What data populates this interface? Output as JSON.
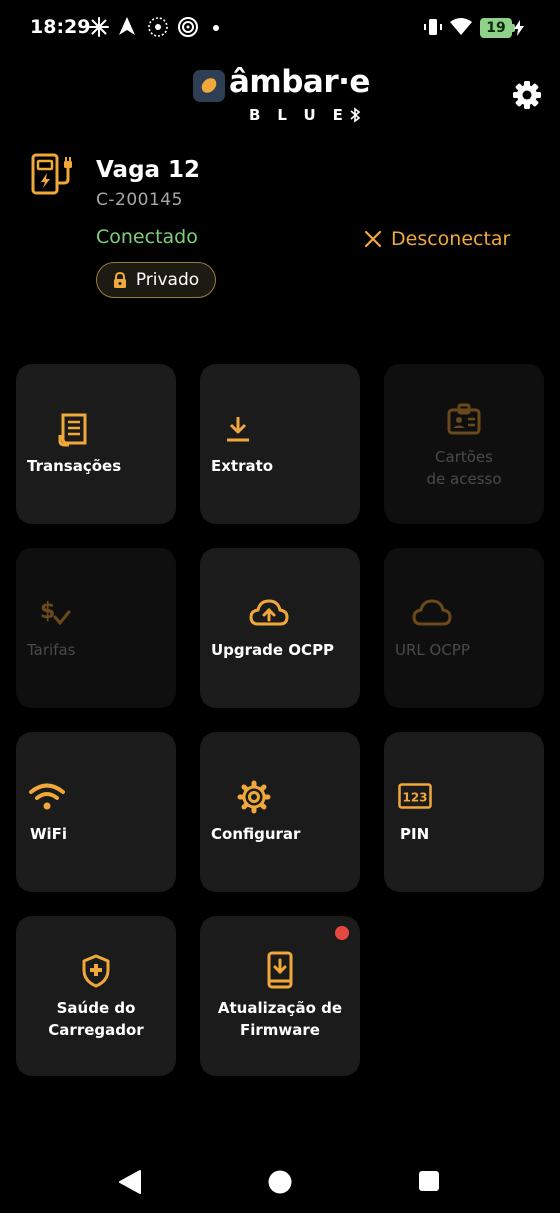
{
  "status_bar": {
    "time": "18:29",
    "battery_level": "19",
    "icons": [
      "pinwheel-icon",
      "navigation-arrow-icon",
      "nfc-dotted-icon",
      "spiral-icon",
      "dot-icon",
      "vibrate-icon",
      "wifi-icon",
      "battery-charging-icon"
    ]
  },
  "header": {
    "brand": "âmbar·e",
    "subbrand": "BLUE",
    "settings_icon": "gear-icon"
  },
  "charger": {
    "name": "Vaga 12",
    "id": "C-200145",
    "status": "Conectado",
    "disconnect_label": "Desconectar",
    "private_label": "Privado"
  },
  "tiles": [
    {
      "label": "Transações",
      "icon": "receipt-icon",
      "enabled": true
    },
    {
      "label": "Extrato",
      "icon": "download-icon",
      "enabled": true
    },
    {
      "label": "Cartões de acesso",
      "icon": "id-card-icon",
      "enabled": false
    },
    {
      "label": "Tarifas",
      "icon": "dollar-check-icon",
      "enabled": false
    },
    {
      "label": "Upgrade OCPP",
      "icon": "cloud-upload-icon",
      "enabled": true
    },
    {
      "label": "URL OCPP",
      "icon": "cloud-icon",
      "enabled": false
    },
    {
      "label": "WiFi",
      "icon": "wifi-icon",
      "enabled": true
    },
    {
      "label": "Configurar",
      "icon": "gear-icon",
      "enabled": true
    },
    {
      "label": "PIN",
      "icon": "pin-123-icon",
      "enabled": true
    },
    {
      "label": "Saúde do Carregador",
      "icon": "shield-plus-icon",
      "enabled": true
    },
    {
      "label": "Atualização de Firmware",
      "icon": "phone-download-icon",
      "enabled": true,
      "notification": true
    }
  ],
  "colors": {
    "accent": "#f0a83a",
    "connected": "#7fcf79",
    "disabled_text": "#4a4a4a",
    "tile_bg": "#1b1b1b",
    "notification": "#e5483e"
  },
  "nav_bar": [
    "back-icon",
    "home-icon",
    "recents-icon"
  ]
}
